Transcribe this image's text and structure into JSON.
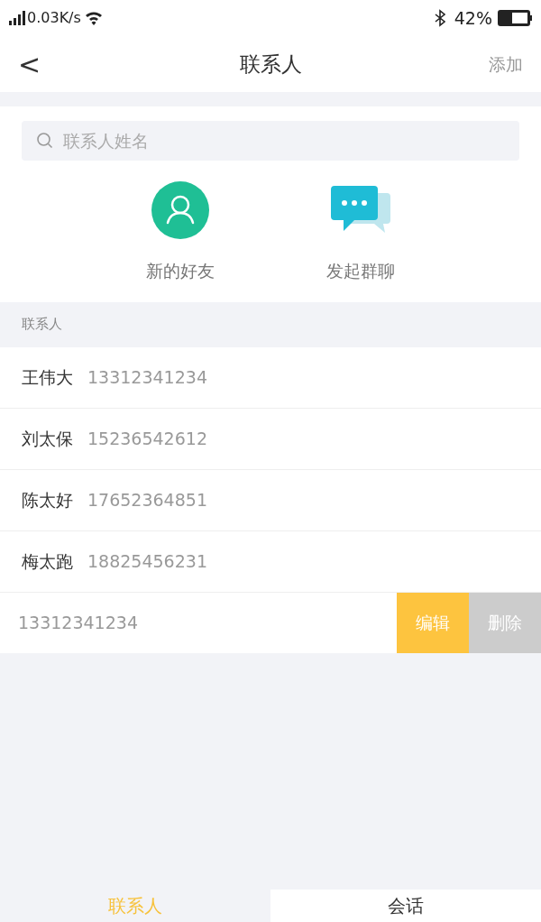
{
  "status_bar": {
    "speed": "0.03K/s",
    "battery": "42%",
    "battery_meter": {
      "level": 0.42
    }
  },
  "nav": {
    "back": "<",
    "title": "联系人",
    "action": "添加"
  },
  "search": {
    "placeholder": "联系人姓名"
  },
  "shortcuts": [
    {
      "kind": "person",
      "label": "新的好友"
    },
    {
      "kind": "chat",
      "label": "发起群聊"
    }
  ],
  "section": "联系人",
  "contacts": [
    {
      "name": "王伟大",
      "phone": "13312341234",
      "swiped": false
    },
    {
      "name": "刘太保",
      "phone": "15236542612",
      "swiped": false
    },
    {
      "name": "陈太好",
      "phone": "17652364851",
      "swiped": false
    },
    {
      "name": "梅太跑",
      "phone": "18825456231",
      "swiped": false
    },
    {
      "phone": "13312341234",
      "swiped": true,
      "actions": [
        {
          "kind": "edit",
          "label": "编辑"
        },
        {
          "kind": "delete",
          "label": "删除"
        }
      ]
    }
  ],
  "tabs": [
    {
      "label": "联系人",
      "selected": true
    },
    {
      "label": "会话",
      "selected": false
    }
  ]
}
